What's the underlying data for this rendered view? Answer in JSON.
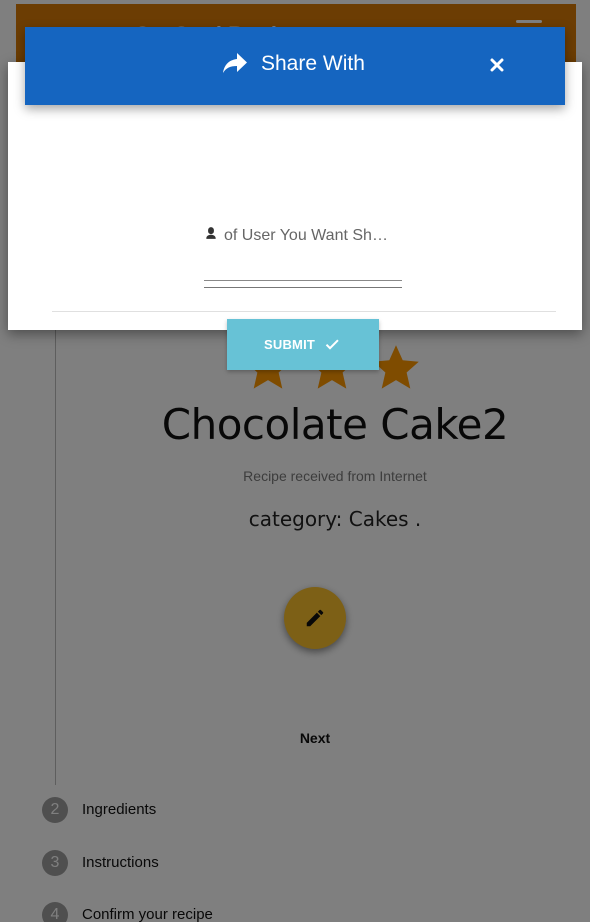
{
  "app": {
    "title": "OurCookBook"
  },
  "recipe": {
    "rating_stars": 3,
    "title": "Chocolate Cake2",
    "source": "Recipe received from Internet",
    "category": "category: Cakes ."
  },
  "actions": {
    "edit_icon": "pencil-icon",
    "next_label": "Next"
  },
  "steps": [
    {
      "number": "2",
      "label": "Ingredients"
    },
    {
      "number": "3",
      "label": "Instructions"
    },
    {
      "number": "4",
      "label": "Confirm your recipe"
    }
  ],
  "share_modal": {
    "title": "Share With",
    "icon": "share-arrow-icon",
    "close_icon": "close-icon",
    "input_label": "of User You Want Sh…",
    "input_icon": "person-icon",
    "input_value": "",
    "submit_label": "SUBMIT",
    "submit_icon": "check-icon"
  },
  "colors": {
    "header_blue": "#1565c0",
    "submit_teal": "#67c2d6",
    "app_bar_orange": "#d97a07",
    "star_orange": "#ff9800",
    "fab_yellow": "#fbc02d"
  }
}
